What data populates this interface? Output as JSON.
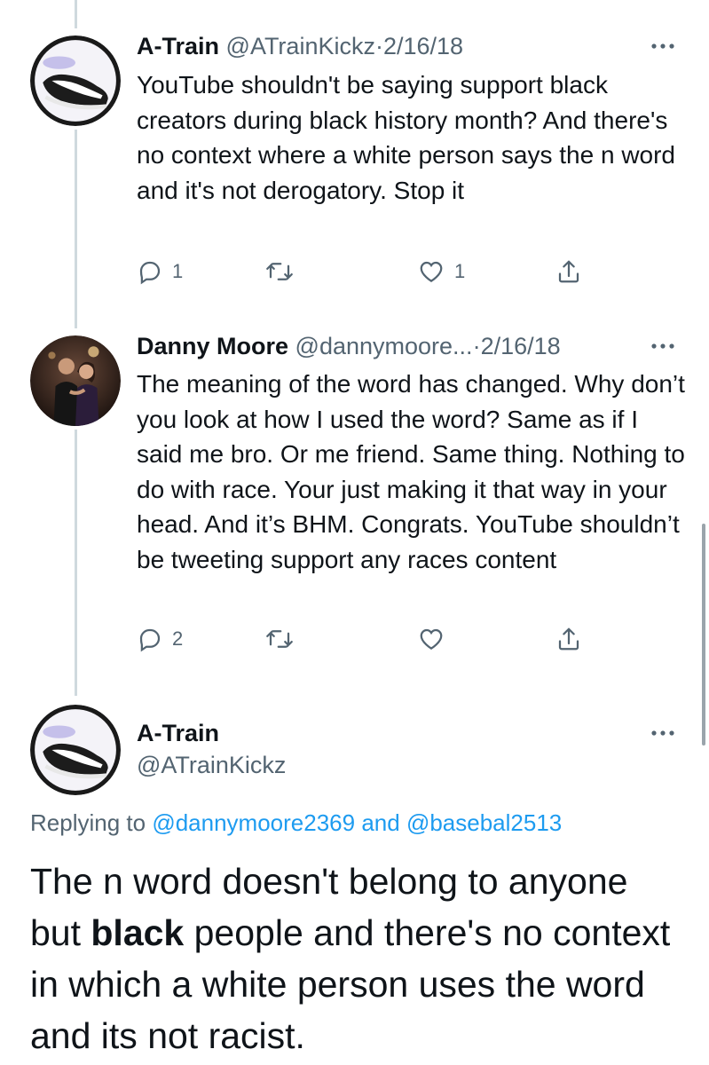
{
  "tweets": [
    {
      "name": "A-Train",
      "handle": "@ATrainKickz",
      "separator": "·",
      "date": "2/16/18",
      "text": "YouTube shouldn't be saying support black creators during black history month? And there's no context where a white person says the n word and it's not derogatory. Stop it",
      "avatar_icon": "sneaker-avatar",
      "replies": "1",
      "retweets": "",
      "likes": "1"
    },
    {
      "name": "Danny Moore",
      "handle": "@dannymoore...",
      "separator": "·",
      "date": "2/16/18",
      "text": "The meaning of the word has changed. Why don’t you look at how I used the word? Same as if I said me bro. Or me friend. Same thing. Nothing to do with race. Your just making it that way in your head. And it’s BHM. Congrats. YouTube shouldn’t be tweeting support any races content",
      "avatar_icon": "couple-photo-avatar",
      "replies": "2",
      "retweets": "",
      "likes": ""
    }
  ],
  "focused": {
    "name": "A-Train",
    "handle": "@ATrainKickz",
    "replying_prefix": "Replying to",
    "reply_to_1": "@dannymoore2369",
    "reply_joiner": "and",
    "reply_to_2": "@basebal2513",
    "text_before": "The n word doesn't belong to anyone but ",
    "text_bold": "black",
    "text_after": " people and there's no context in which a white person uses the word and its not racist.",
    "avatar_icon": "sneaker-avatar"
  },
  "icons": [
    "more-icon",
    "reply-icon",
    "retweet-icon",
    "like-icon",
    "share-icon"
  ],
  "colors": {
    "text": "#0f1419",
    "muted": "#536471",
    "link": "#1d9bf0",
    "thread_line": "#cfd9de"
  }
}
